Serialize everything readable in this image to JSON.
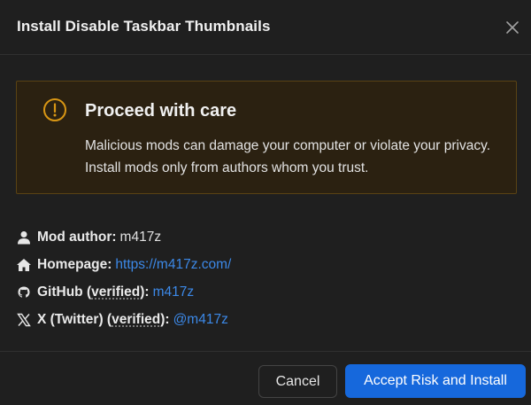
{
  "dialog": {
    "title": "Install Disable Taskbar Thumbnails"
  },
  "warning": {
    "title": "Proceed with care",
    "text": "Malicious mods can damage your computer or violate your privacy. Install mods only from authors whom you trust.",
    "icon": "exclamation-circle-icon",
    "color": "#d89614"
  },
  "info": {
    "author": {
      "label": "Mod author:",
      "value": "m417z",
      "icon": "user-icon"
    },
    "homepage": {
      "label": "Homepage:",
      "value": "https://m417z.com/",
      "icon": "home-icon"
    },
    "github": {
      "label_main": "GitHub (",
      "label_verified": "verified",
      "label_end": "):",
      "value": "m417z",
      "icon": "github-icon"
    },
    "twitter": {
      "label_main": "X (Twitter) (",
      "label_verified": "verified",
      "label_end": "):",
      "value": "@m417z",
      "icon": "x-icon"
    }
  },
  "footer": {
    "cancel_label": "Cancel",
    "accept_label": "Accept Risk and Install",
    "accent": "#1668dc"
  }
}
